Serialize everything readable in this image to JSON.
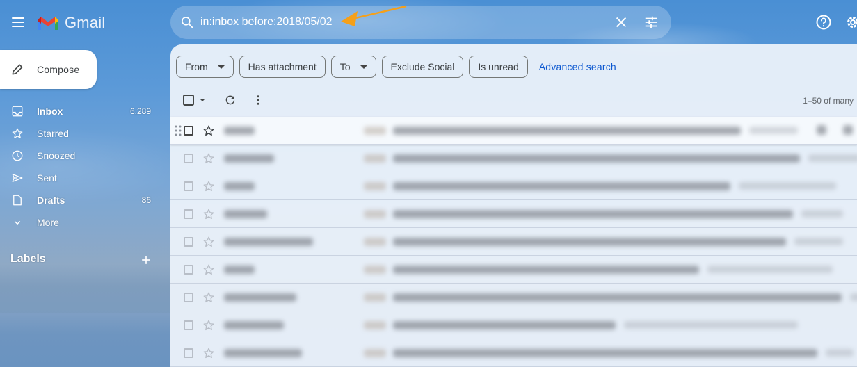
{
  "app": {
    "name": "Gmail",
    "logo_colors": [
      "#4285f4",
      "#ea4335",
      "#fbbc04",
      "#34a853",
      "#c5221f"
    ]
  },
  "header": {
    "menu_icon": "hamburger-menu-icon",
    "search": {
      "query": "in:inbox before:2018/05/02",
      "search_icon": "search-icon",
      "clear_icon": "close-icon",
      "options_icon": "tune-icon"
    },
    "annotation_arrow_color": "#f5a01a",
    "help_icon": "help-icon",
    "settings_icon": "gear-icon"
  },
  "sidebar": {
    "compose_label": "Compose",
    "items": [
      {
        "label": "Inbox",
        "count": "6,289",
        "icon": "inbox-icon",
        "bold": true
      },
      {
        "label": "Starred",
        "count": "",
        "icon": "star-icon",
        "bold": false
      },
      {
        "label": "Snoozed",
        "count": "",
        "icon": "clock-icon",
        "bold": false
      },
      {
        "label": "Sent",
        "count": "",
        "icon": "send-icon",
        "bold": false
      },
      {
        "label": "Drafts",
        "count": "86",
        "icon": "draft-icon",
        "bold": true
      },
      {
        "label": "More",
        "count": "",
        "icon": "chevron-down-icon",
        "bold": false
      }
    ],
    "labels_heading": "Labels",
    "labels_add_icon": "plus-icon"
  },
  "filters": {
    "chips": [
      {
        "label": "From",
        "dropdown": true
      },
      {
        "label": "Has attachment",
        "dropdown": false
      },
      {
        "label": "To",
        "dropdown": true
      },
      {
        "label": "Exclude Social",
        "dropdown": false
      },
      {
        "label": "Is unread",
        "dropdown": false
      }
    ],
    "advanced_search_label": "Advanced search"
  },
  "toolbar": {
    "pagination": "1–50 of many"
  },
  "email_list": {
    "content_redacted": true,
    "row_count": 9,
    "rows": [
      {
        "starred": false,
        "hovered": true
      },
      {
        "starred": false,
        "hovered": false
      },
      {
        "starred": false,
        "hovered": false
      },
      {
        "starred": false,
        "hovered": false
      },
      {
        "starred": false,
        "hovered": false
      },
      {
        "starred": false,
        "hovered": false
      },
      {
        "starred": false,
        "hovered": false
      },
      {
        "starred": false,
        "hovered": false
      },
      {
        "starred": false,
        "hovered": false
      }
    ]
  }
}
